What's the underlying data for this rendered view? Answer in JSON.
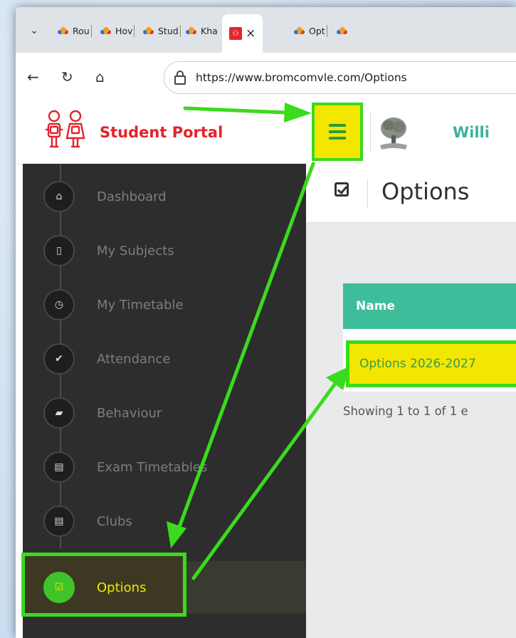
{
  "browser": {
    "tabs": [
      {
        "label": "Rou"
      },
      {
        "label": "Hov"
      },
      {
        "label": "Stud"
      },
      {
        "label": "Kha"
      },
      {
        "label": "",
        "close": "×"
      },
      {
        "label": "Opt"
      }
    ],
    "url": "https://www.bromcomvle.com/Options"
  },
  "header": {
    "brand": "Student Portal",
    "school_name": "Willi"
  },
  "sidebar": {
    "items": [
      {
        "label": "Dashboard",
        "icon": "home-icon"
      },
      {
        "label": "My Subjects",
        "icon": "file-icon"
      },
      {
        "label": "My Timetable",
        "icon": "clock-icon"
      },
      {
        "label": "Attendance",
        "icon": "check-icon"
      },
      {
        "label": "Behaviour",
        "icon": "graduation-cap-icon"
      },
      {
        "label": "Exam Timetables",
        "icon": "list-card-icon"
      },
      {
        "label": "Clubs",
        "icon": "list-card-icon"
      },
      {
        "label": "Options",
        "icon": "checkbox-icon",
        "active": true
      }
    ]
  },
  "main": {
    "title": "Options",
    "table": {
      "column_header": "Name",
      "rows": [
        "Options 2026-2027"
      ]
    },
    "showing": "Showing 1 to 1 of 1 e"
  },
  "colors": {
    "highlight_green": "#3adb1d",
    "highlight_yellow": "#f3e600",
    "brand_red": "#e3232a",
    "teal": "#3dbd9a"
  }
}
